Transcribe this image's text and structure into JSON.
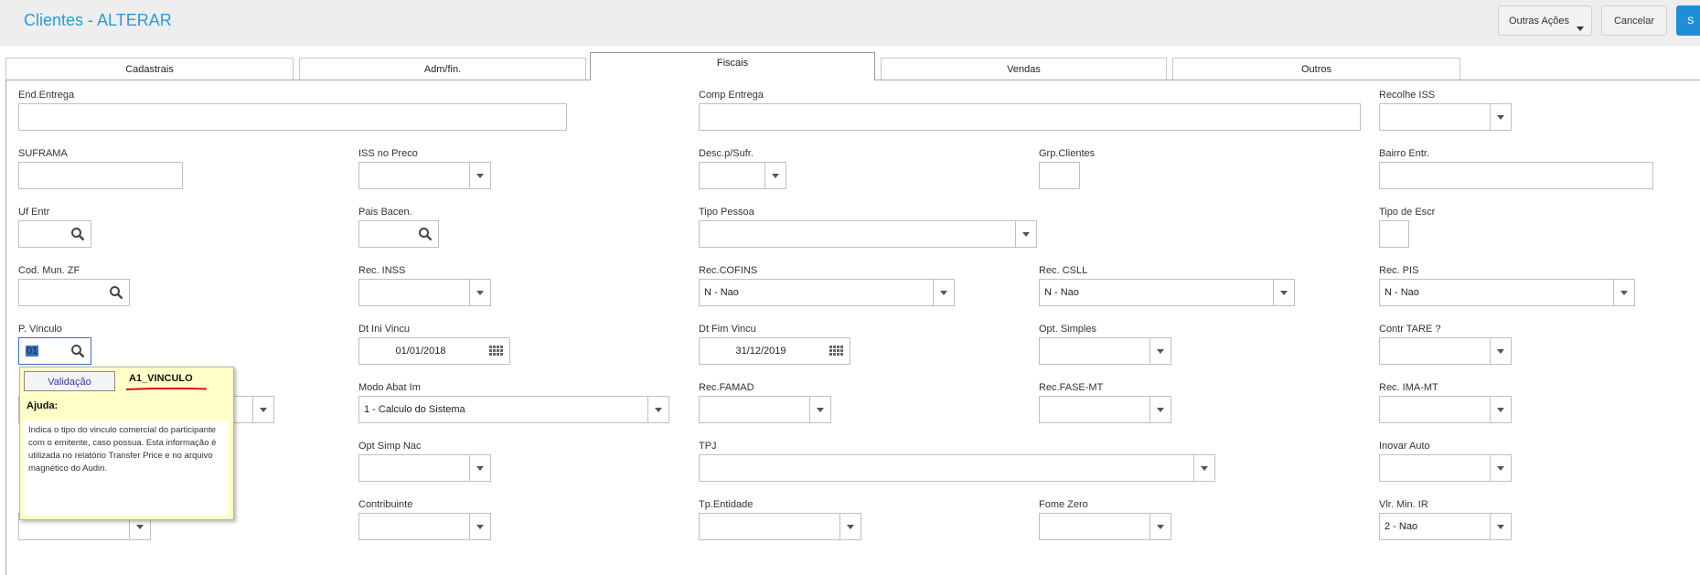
{
  "header": {
    "title": "Clientes - ALTERAR",
    "outras_acoes": "Outras Ações",
    "cancelar": "Cancelar",
    "salvar": "S"
  },
  "tabs": [
    "Cadastrais",
    "Adm/fin.",
    "Fiscais",
    "Vendas",
    "Outros"
  ],
  "active_tab": "Fiscais",
  "fields": {
    "end_entrega": {
      "label": "End.Entrega",
      "value": ""
    },
    "comp_entrega": {
      "label": "Comp Entrega",
      "value": ""
    },
    "recolhe_iss": {
      "label": "Recolhe ISS",
      "value": ""
    },
    "suframa": {
      "label": "SUFRAMA",
      "value": ""
    },
    "iss_no_preco": {
      "label": "ISS no Preco",
      "value": ""
    },
    "desc_p_sufr": {
      "label": "Desc.p/Sufr.",
      "value": ""
    },
    "grp_clientes": {
      "label": "Grp.Clientes",
      "value": ""
    },
    "bairro_entr": {
      "label": "Bairro Entr.",
      "value": ""
    },
    "uf_entr": {
      "label": "Uf Entr",
      "value": ""
    },
    "pais_bacen": {
      "label": "Pais Bacen.",
      "value": ""
    },
    "tipo_pessoa": {
      "label": "Tipo Pessoa",
      "value": ""
    },
    "tipo_de_escr": {
      "label": "Tipo de Escr",
      "value": ""
    },
    "cod_mun_zf": {
      "label": "Cod. Mun. ZF",
      "value": ""
    },
    "rec_inss": {
      "label": "Rec. INSS",
      "value": ""
    },
    "rec_cofins": {
      "label": "Rec.COFINS",
      "value": "N - Nao"
    },
    "rec_csll": {
      "label": "Rec. CSLL",
      "value": "N - Nao"
    },
    "rec_pis": {
      "label": "Rec. PIS",
      "value": "N - Nao"
    },
    "p_vinculo": {
      "label": "P. Vinculo",
      "value": "01"
    },
    "dt_ini_vincu": {
      "label": "Dt Ini Vincu",
      "value": "01/01/2018"
    },
    "dt_fim_vincu": {
      "label": "Dt Fim Vincu",
      "value": "31/12/2019"
    },
    "opt_simples": {
      "label": "Opt. Simples",
      "value": ""
    },
    "contr_tare": {
      "label": "Contr TARE ?",
      "value": ""
    },
    "modo_abat_im": {
      "label": "Modo Abat Im",
      "value": "1 - Calculo do Sistema"
    },
    "rec_famad": {
      "label": "Rec.FAMAD",
      "value": ""
    },
    "rec_fase_mt": {
      "label": "Rec.FASE-MT",
      "value": ""
    },
    "rec_ima_mt": {
      "label": "Rec. IMA-MT",
      "value": ""
    },
    "opt_simp_nac": {
      "label": "Opt Simp Nac",
      "value": ""
    },
    "tpj": {
      "label": "TPJ",
      "value": ""
    },
    "inovar_auto": {
      "label": "Inovar Auto",
      "value": ""
    },
    "contribuinte": {
      "label": "Contribuinte",
      "value": ""
    },
    "tp_entidade": {
      "label": "Tp.Entidade",
      "value": ""
    },
    "fome_zero": {
      "label": "Fome Zero",
      "value": ""
    },
    "vlr_min_ir": {
      "label": "Vlr. Min. IR",
      "value": "2 - Nao"
    }
  },
  "popup": {
    "button": "Validação",
    "code": "A1_VINCULO",
    "ajuda_label": "Ajuda:",
    "text": "Indica o tipo do vinculo comercial do participante com o emitente, caso possua. Esta informação é utilizada no relatório Transfer Price e no arquivo magnético do Audin."
  },
  "colors": {
    "title": "#2b9bd8",
    "save_button": "#1e8fd6",
    "popup_bg": "#ffffc8",
    "underline": "#e01010"
  }
}
